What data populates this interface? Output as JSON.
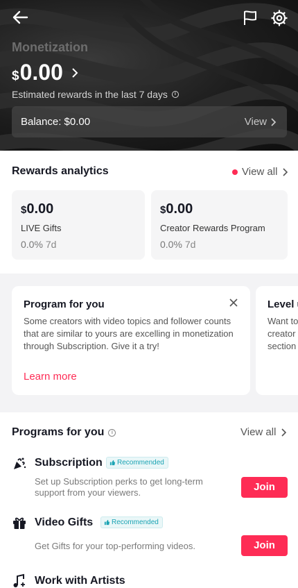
{
  "header": {
    "title": "Monetization",
    "currency_symbol": "$",
    "amount": "0.00",
    "estimated_label": "Estimated rewards in the last 7 days",
    "balance_label": "Balance: $0.00",
    "view_label": "View"
  },
  "rewards_analytics": {
    "title": "Rewards analytics",
    "view_all": "View all",
    "cards": [
      {
        "currency": "$",
        "amount": "0.00",
        "name": "LIVE Gifts",
        "percent": "0.0%",
        "period": "7d"
      },
      {
        "currency": "$",
        "amount": "0.00",
        "name": "Creator Rewards Program",
        "percent": "0.0%",
        "period": "7d"
      }
    ]
  },
  "program_cards": [
    {
      "title": "Program for you",
      "description": "Some creators with video topics and follower counts that are similar to yours are excelling in monetization through Subscription. Give it a try!",
      "link": "Learn more"
    },
    {
      "title": "Level u",
      "description": "Want to\ncreator\nsection"
    }
  ],
  "programs_for_you": {
    "title": "Programs for you",
    "view_all": "View all",
    "items": [
      {
        "name": "Subscription",
        "badge": "Recommended",
        "description": "Set up Subscription perks to get long-term support from your viewers.",
        "action": "Join"
      },
      {
        "name": "Video Gifts",
        "badge": "Recommended",
        "description": "Get Gifts for your top-performing videos.",
        "action": "Join"
      },
      {
        "name": "Work with Artists"
      }
    ]
  },
  "colors": {
    "accent": "#fe2c55",
    "badge_text": "#1aa3b3",
    "header_bg": "#1c1c1c"
  },
  "icons": [
    "back-arrow-icon",
    "flag-icon",
    "gear-icon",
    "chevron-right-icon",
    "info-icon",
    "close-icon",
    "subscription-icon",
    "gift-icon",
    "music-note-icon",
    "thumbs-up-icon"
  ]
}
